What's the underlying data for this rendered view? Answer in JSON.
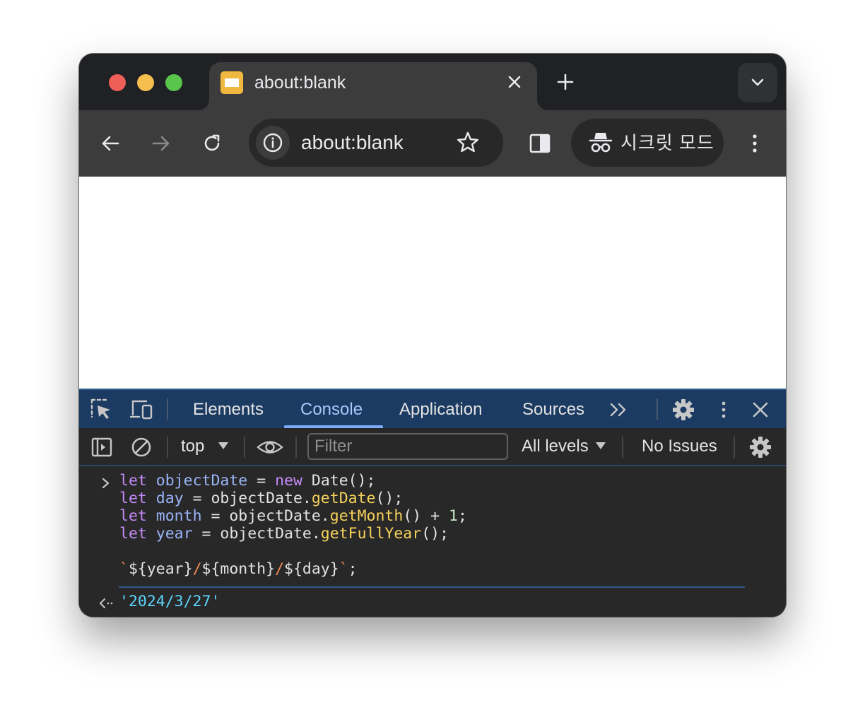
{
  "window": {
    "tab": {
      "title": "about:blank"
    },
    "toolbar": {
      "url": "about:blank",
      "profile_label": "시크릿 모드"
    }
  },
  "devtools": {
    "tabs": [
      {
        "label": "Elements"
      },
      {
        "label": "Console"
      },
      {
        "label": "Application"
      },
      {
        "label": "Sources"
      }
    ],
    "active_tab": "Console",
    "console_toolbar": {
      "context": "top",
      "filter_placeholder": "Filter",
      "levels": "All levels",
      "issues": "No Issues"
    },
    "console": {
      "input_lines": [
        "let objectDate = new Date();",
        "let day = objectDate.getDate();",
        "let month = objectDate.getMonth() + 1;",
        "let year = objectDate.getFullYear();",
        "",
        "`${year}/${month}/${day}`;"
      ],
      "result": "'2024/3/27'"
    }
  },
  "colors": {
    "keyword": "#c58af9",
    "variable": "#9ab4f8",
    "function": "#f7d25b",
    "string": "#5cd5fb",
    "devtools_tabbar": "#1c3b62"
  },
  "icons": [
    "back-arrow-icon",
    "forward-arrow-icon",
    "reload-icon",
    "info-icon",
    "star-icon",
    "side-panel-icon",
    "incognito-icon",
    "more-vert-icon",
    "inspect-element-icon",
    "device-toolbar-icon",
    "more-tabs-chevron-icon",
    "gear-icon",
    "close-icon",
    "sidebar-toggle-icon",
    "clear-console-icon",
    "dropdown-triangle-icon",
    "eye-icon",
    "prompt-chevron-icon",
    "return-arrow-icon"
  ]
}
